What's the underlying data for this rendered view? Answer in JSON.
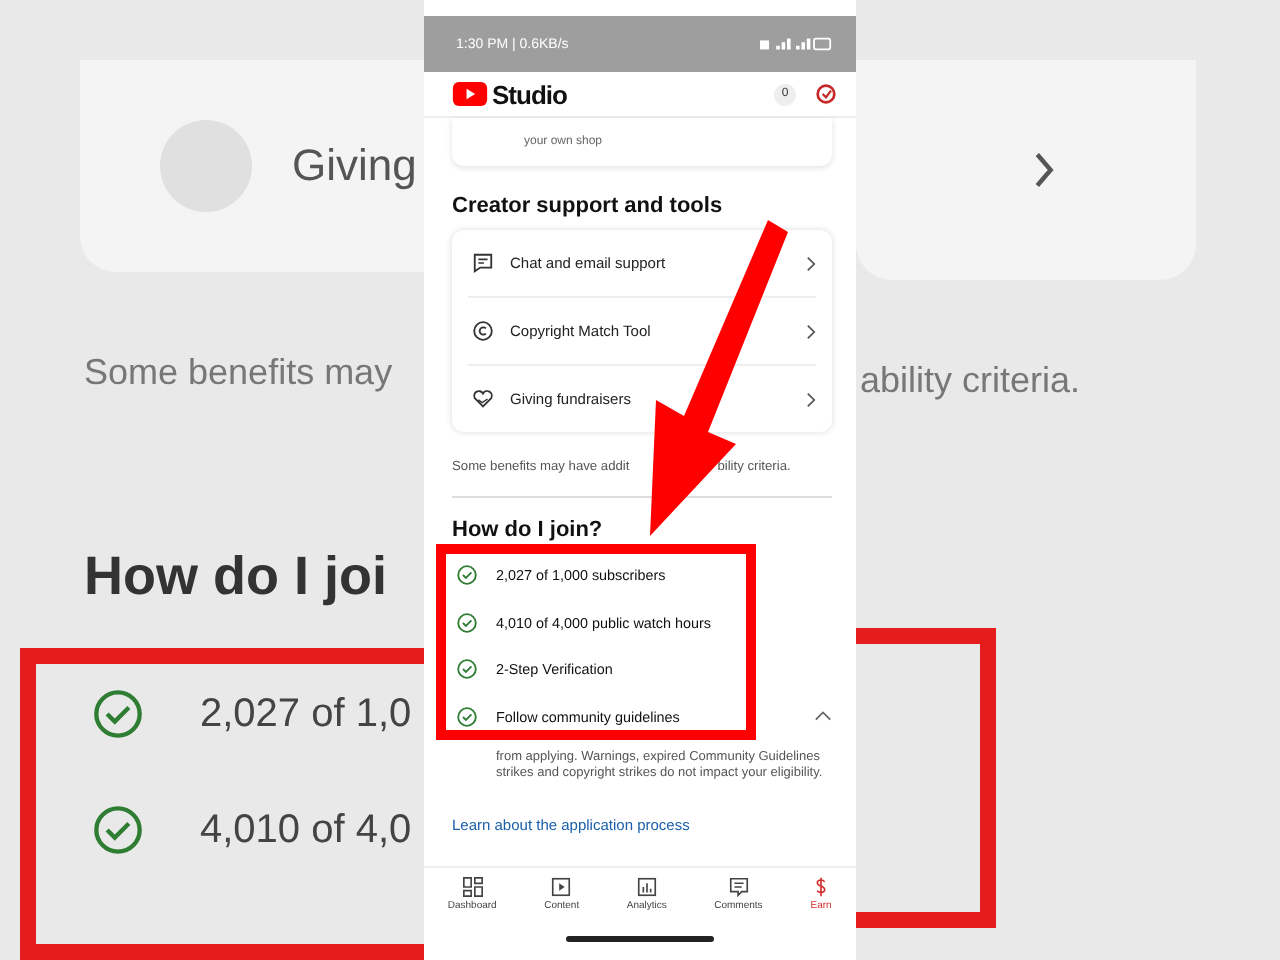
{
  "backdrop": {
    "card_label": "Giving",
    "note_left": "Some benefits may",
    "note_right": "ability criteria.",
    "heading": "How do I joi",
    "checks": [
      "2,027 of 1,0",
      "4,010 of 4,0"
    ]
  },
  "status_bar": {
    "time": "1:30 PM | 0.6KB/s"
  },
  "header": {
    "title": "Studio",
    "notifications": "0"
  },
  "shop_card": {
    "text": "your own shop"
  },
  "support": {
    "title": "Creator support and tools",
    "items": [
      {
        "kind": "chat",
        "label": "Chat and email support"
      },
      {
        "kind": "copyright",
        "label": "Copyright Match Tool"
      },
      {
        "kind": "giving",
        "label": "Giving fundraisers"
      }
    ],
    "note": [
      "Some benefits may have addit",
      "bility criteria."
    ]
  },
  "join": {
    "title": "How do I join?",
    "requirements": [
      {
        "label": "2,027 of 1,000 subscribers",
        "checked": true
      },
      {
        "label": "4,010 of 4,000 public watch hours",
        "checked": true
      },
      {
        "label": "2-Step Verification",
        "checked": true
      },
      {
        "label": "Follow community guidelines",
        "checked": true,
        "expanded": true
      }
    ],
    "details": "from applying. Warnings, expired Community Guidelines strikes and copyright strikes do not impact your eligibility.",
    "link": "Learn about the application process"
  },
  "nav": [
    {
      "kind": "dashboard",
      "label": "Dashboard",
      "selected": false
    },
    {
      "kind": "content",
      "label": "Content",
      "selected": false
    },
    {
      "kind": "analytics",
      "label": "Analytics",
      "selected": false
    },
    {
      "kind": "comments",
      "label": "Comments",
      "selected": false
    },
    {
      "kind": "earn",
      "label": "Earn",
      "selected": true
    }
  ]
}
